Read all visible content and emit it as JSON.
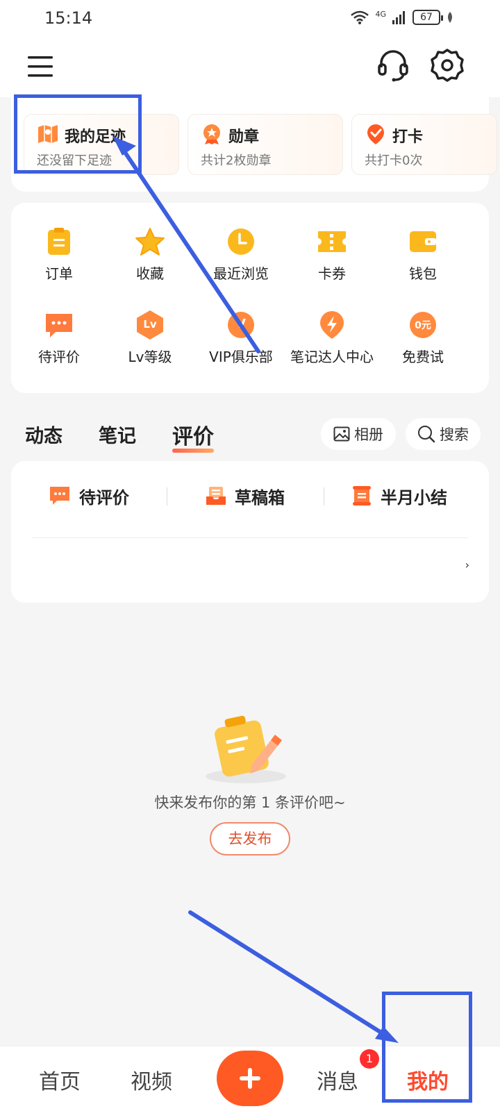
{
  "status_bar": {
    "time": "15:14",
    "battery": "67",
    "network": "4G"
  },
  "shortcut_cards": [
    {
      "title": "我的足迹",
      "subtitle": "还没留下足迹",
      "icon": "map-pin-icon"
    },
    {
      "title": "勋章",
      "subtitle": "共计2枚勋章",
      "icon": "medal-icon"
    },
    {
      "title": "打卡",
      "subtitle": "共打卡0次",
      "icon": "checkin-icon"
    }
  ],
  "functions": [
    {
      "label": "订单",
      "icon": "order-icon"
    },
    {
      "label": "收藏",
      "icon": "star-icon"
    },
    {
      "label": "最近浏览",
      "icon": "clock-icon"
    },
    {
      "label": "卡券",
      "icon": "coupon-icon"
    },
    {
      "label": "钱包",
      "icon": "wallet-icon"
    },
    {
      "label": "待评价",
      "icon": "comment-icon"
    },
    {
      "label": "Lv等级",
      "icon": "level-icon",
      "badge": "Lv"
    },
    {
      "label": "VIP俱乐部",
      "icon": "vip-icon",
      "badge": "V"
    },
    {
      "label": "笔记达人中心",
      "icon": "lightning-icon"
    },
    {
      "label": "免费试",
      "icon": "free-trial-icon",
      "badge": "0元"
    }
  ],
  "tabs": [
    "动态",
    "笔记",
    "评价"
  ],
  "active_tab": "评价",
  "pills": {
    "album": "相册",
    "search": "搜索"
  },
  "review_shortcuts": [
    "待评价",
    "草稿箱",
    "半月小结"
  ],
  "empty_state": {
    "message": "快来发布你的第 1 条评价吧~",
    "button": "去发布"
  },
  "bottom_nav": {
    "home": "首页",
    "video": "视频",
    "messages": "消息",
    "mine": "我的",
    "message_badge": "1"
  },
  "colors": {
    "accent": "#ff5a23",
    "annotation": "#3c5ee0",
    "icon_yellow": "#fbb81d"
  }
}
